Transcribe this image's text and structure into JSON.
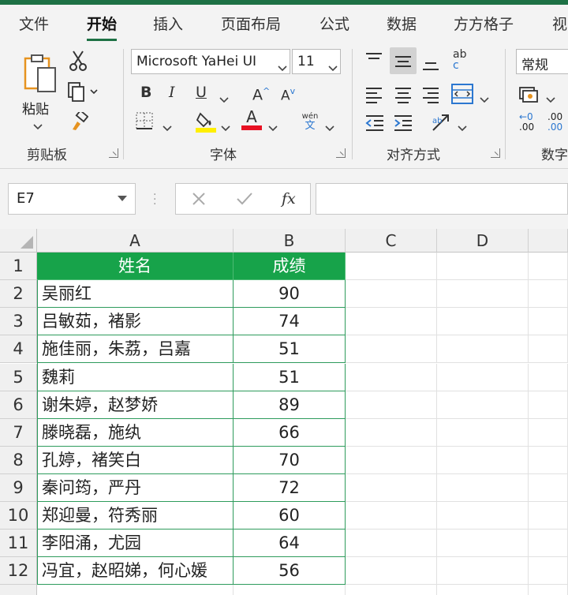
{
  "tabs": [
    "文件",
    "开始",
    "插入",
    "页面布局",
    "公式",
    "数据",
    "方方格子",
    "视"
  ],
  "active_tab": "开始",
  "ribbon": {
    "clipboard": {
      "paste_label": "粘贴",
      "group_label": "剪贴板"
    },
    "font": {
      "font_name": "Microsoft YaHei UI",
      "font_size": "11",
      "bold": "B",
      "italic": "I",
      "underline": "U",
      "grow": "A",
      "shrink": "A",
      "font_color_letter": "A",
      "phonetic_top": "wén",
      "phonetic_bottom": "文",
      "group_label": "字体",
      "fill_color": "#ffef00",
      "font_color": "#e81123"
    },
    "alignment": {
      "group_label": "对齐方式",
      "wrap_top": "ab",
      "wrap_bottom": "c"
    },
    "number": {
      "format": "常规",
      "group_label": "数字",
      "inc_decimal": ".00",
      "dec_decimal": ".00"
    }
  },
  "formula_bar": {
    "name_box": "E7",
    "fx": "fx",
    "formula": ""
  },
  "columns": [
    "A",
    "B",
    "C",
    "D"
  ],
  "rows": [
    "1",
    "2",
    "3",
    "4",
    "5",
    "6",
    "7",
    "8",
    "9",
    "10",
    "11",
    "12"
  ],
  "table": {
    "headers": [
      "姓名",
      "成绩"
    ],
    "rows": [
      [
        "吴丽红",
        "90"
      ],
      [
        "吕敏茹，褚影",
        "74"
      ],
      [
        "施佳丽，朱荔，吕嘉",
        "51"
      ],
      [
        "魏莉",
        "51"
      ],
      [
        "谢朱婷，赵梦娇",
        "89"
      ],
      [
        "滕晓磊，施纨",
        "66"
      ],
      [
        "孔婷，褚笑白",
        "70"
      ],
      [
        "秦问筠，严丹",
        "72"
      ],
      [
        "郑迎曼，符秀丽",
        "60"
      ],
      [
        "李阳涌，尤园",
        "64"
      ],
      [
        "冯宜，赵昭娣，何心媛",
        "56"
      ]
    ]
  },
  "colors": {
    "accent": "#1e7145",
    "header_fill": "#17a34a",
    "table_border": "#2e9b5c"
  }
}
